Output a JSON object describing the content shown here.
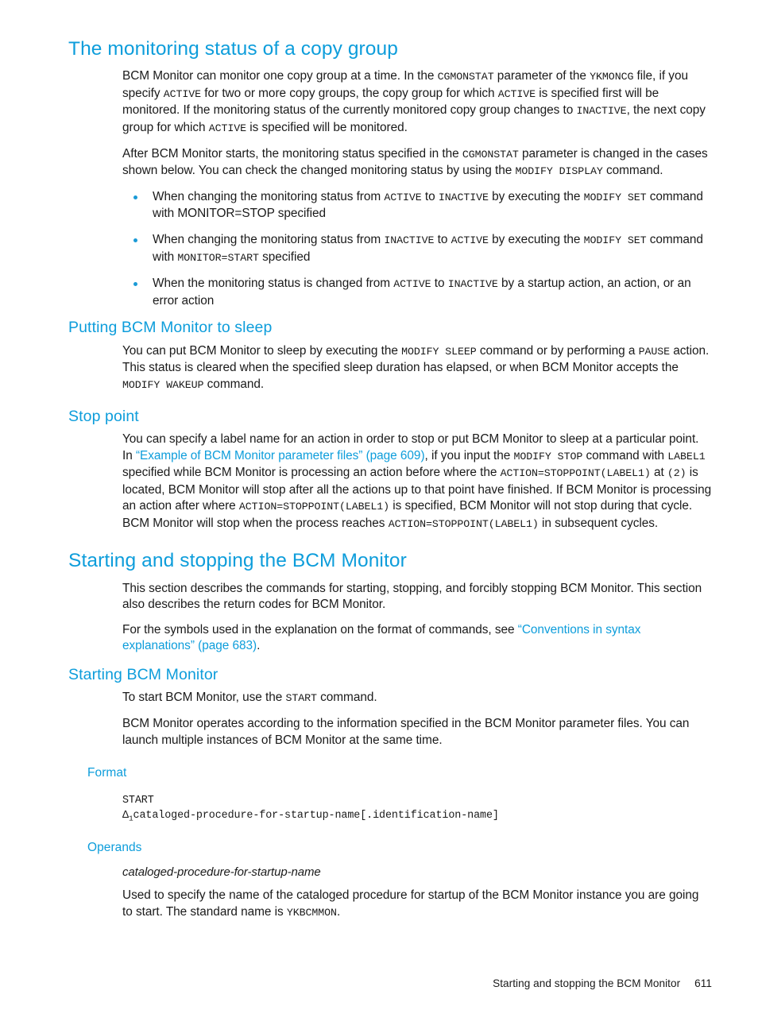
{
  "doc": {
    "page_number": "611",
    "footer_title": "Starting and stopping the BCM Monitor",
    "accent_color": "#0d9ddb",
    "bullet_color": "#1b9ad6"
  },
  "sections": {
    "monitoring_status": {
      "heading": "The monitoring status of a copy group",
      "p1": {
        "t1": "BCM Monitor can monitor one copy group at a time. In the ",
        "c1": "CGMONSTAT",
        "t2": " parameter of the ",
        "c2": "YKMONCG",
        "t3": " file, if you specify ",
        "c3": "ACTIVE",
        "t4": " for two or more copy groups, the copy group for which ",
        "c4": "ACTIVE",
        "t5": " is specified first will be monitored. If the monitoring status of the currently monitored copy group changes to ",
        "c5": "INACTIVE",
        "t6": ", the next copy group for which ",
        "c6": "ACTIVE",
        "t7": " is specified will be monitored."
      },
      "p2": {
        "t1": "After BCM Monitor starts, the monitoring status specified in the ",
        "c1": "CGMONSTAT",
        "t2": " parameter is changed in the cases shown below. You can check the changed monitoring status by using the ",
        "c2": "MODIFY DISPLAY",
        "t3": " command."
      },
      "bullets": [
        {
          "t1": "When changing the monitoring status from ",
          "c1": "ACTIVE",
          "t2": " to ",
          "c2": "INACTIVE",
          "t3": " by executing the ",
          "c3": "MODIFY SET",
          "t4": " command with MONITOR=STOP specified",
          "c4": "",
          "t5": ""
        },
        {
          "t1": "When changing the monitoring status from ",
          "c1": "INACTIVE",
          "t2": " to ",
          "c2": "ACTIVE",
          "t3": " by executing the ",
          "c3": "MODIFY SET",
          "t4": " command with ",
          "c4": "MONITOR=START",
          "t5": " specified"
        },
        {
          "t1": "When the monitoring status is changed from ",
          "c1": "ACTIVE",
          "t2": " to ",
          "c2": "INACTIVE",
          "t3": " by a startup action, an action, or an error action",
          "c3": "",
          "t4": "",
          "c4": "",
          "t5": ""
        }
      ]
    },
    "sleep": {
      "heading": "Putting BCM Monitor to sleep",
      "p1": {
        "t1": "You can put BCM Monitor to sleep by executing the ",
        "c1": "MODIFY SLEEP",
        "t2": " command or by performing a ",
        "c2": "PAUSE",
        "t3": " action. This status is cleared when the specified sleep duration has elapsed, or when BCM Monitor accepts the ",
        "c3": "MODIFY WAKEUP",
        "t4": " command."
      }
    },
    "stop_point": {
      "heading": "Stop point",
      "p1": {
        "t1": "You can specify a label name for an action in order to stop or put BCM Monitor to sleep at a particular point. In ",
        "link": "“Example of BCM Monitor parameter files” (page 609)",
        "t2": ", if you input the ",
        "c1": "MODIFY STOP",
        "t3": " command with ",
        "c2": "LABEL1",
        "t4": " specified while BCM Monitor is processing an action before where the ",
        "c3": "ACTION=STOPPOINT(LABEL1)",
        "t5": " at ",
        "c4": "(2)",
        "t6": " is located, BCM Monitor will stop after all the actions up to that point have finished. If BCM Monitor is processing an action after where ",
        "c5": "ACTION=STOPPOINT(LABEL1)",
        "t7": "  is specified, BCM Monitor will not stop during that cycle. BCM Monitor will stop when the process reaches ",
        "c6": "ACTION=STOPPOINT(LABEL1)",
        "t8": " in subsequent cycles."
      }
    },
    "starting_stopping": {
      "heading": "Starting and stopping the BCM Monitor",
      "p1": "This section describes the commands for starting, stopping, and forcibly stopping BCM Monitor. This section also describes the return codes for BCM Monitor.",
      "p2": {
        "t1": "For the symbols used in the explanation on the format of commands, see ",
        "link": "“Conventions in syntax explanations” (page 683)",
        "t2": "."
      }
    },
    "starting_bcm": {
      "heading": "Starting BCM Monitor",
      "p1": {
        "t1": "To start BCM Monitor, use the ",
        "c1": "START",
        "t2": " command."
      },
      "p2": "BCM Monitor operates according to the information specified in the BCM Monitor parameter files. You can launch multiple instances of BCM Monitor at the same time.",
      "format": {
        "heading": "Format",
        "line1": "START",
        "line2_prefix": "Δ",
        "line2_sub": "1",
        "line2_rest": "cataloged-procedure-for-startup-name[.identification-name]"
      },
      "operands": {
        "heading": "Operands",
        "name": "cataloged-procedure-for-startup-name",
        "desc": {
          "t1": "Used to specify the name of the cataloged procedure for startup of the BCM Monitor instance you are going to start. The standard name is ",
          "c1": "YKBCMMON",
          "t2": "."
        }
      }
    }
  }
}
